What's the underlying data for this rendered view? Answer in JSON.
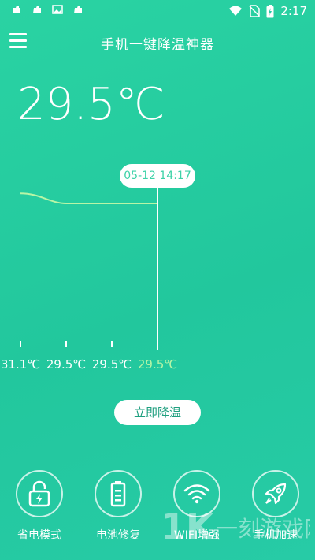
{
  "status_bar": {
    "time": "2:17"
  },
  "header": {
    "title": "手机一键降温神器"
  },
  "current_temp": "29.5℃",
  "chart_data": {
    "type": "line",
    "categories": [
      "31.1℃",
      "29.5℃",
      "29.5℃",
      "29.5℃"
    ],
    "values": [
      31.1,
      29.5,
      29.5,
      29.5
    ],
    "highlight_index": 3,
    "tooltip": "05-12 14:17",
    "title": "",
    "xlabel": "",
    "ylabel": ""
  },
  "actions": {
    "cool_button": "立即降温"
  },
  "features": [
    {
      "label": "省电模式",
      "icon": "lock-bolt-icon"
    },
    {
      "label": "电池修复",
      "icon": "battery-icon"
    },
    {
      "label": "WIFI增强",
      "icon": "wifi-icon"
    },
    {
      "label": "手机加速",
      "icon": "rocket-icon"
    }
  ],
  "colors": {
    "accent": "#22c79d",
    "highlight": "#b8f5a6"
  }
}
